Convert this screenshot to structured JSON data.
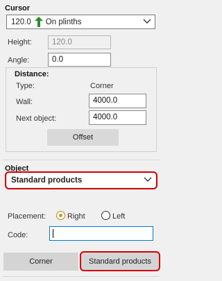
{
  "cursor": {
    "title": "Cursor",
    "height_value": "120.0",
    "mode_label": "On plinths",
    "height_label": "Height:",
    "height_field": "120.0",
    "angle_label": "Angle:",
    "angle_field": "0.0"
  },
  "distance": {
    "title": "Distance:",
    "type_label": "Type:",
    "type_value": "Corner",
    "wall_label": "Wall:",
    "wall_value": "4000.0",
    "next_label": "Next object:",
    "next_value": "4000.0",
    "offset_button": "Offset"
  },
  "object": {
    "title": "Object",
    "selected": "Standard products",
    "placement_label": "Placement:",
    "placement_options": [
      "Right",
      "Left"
    ],
    "placement_selected": "Right",
    "code_label": "Code:",
    "code_value": ""
  },
  "footer": {
    "tabs": [
      "Corner",
      "Standard products"
    ],
    "active_tab": "Standard products"
  },
  "colors": {
    "highlight": "#d40000",
    "arrow": "#2e8b2e",
    "radio_selected": "#c99a1f",
    "focus_border": "#0078d7"
  },
  "icons": {
    "height_arrow": "up-arrow-icon",
    "dropdown": "chevron-down-icon"
  }
}
